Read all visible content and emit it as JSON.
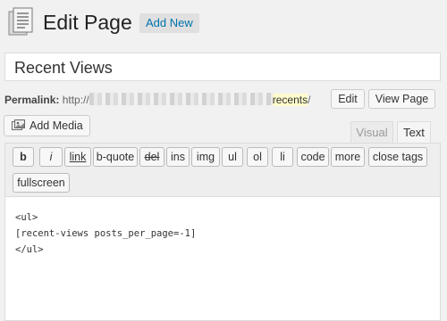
{
  "header": {
    "title": "Edit Page",
    "add_new_label": "Add New"
  },
  "post": {
    "title": "Recent Views"
  },
  "permalink": {
    "label": "Permalink:",
    "url_prefix": "http://",
    "slug": "recents",
    "url_suffix": "/",
    "edit_label": "Edit",
    "view_label": "View Page"
  },
  "media": {
    "add_media_label": "Add Media"
  },
  "editor_tabs": {
    "visual": "Visual",
    "text": "Text",
    "active": "Text"
  },
  "quicktags": [
    {
      "label": "b"
    },
    {
      "label": "i"
    },
    {
      "label": "link"
    },
    {
      "label": "b-quote"
    },
    {
      "label": "del"
    },
    {
      "label": "ins"
    },
    {
      "label": "img"
    },
    {
      "label": "ul"
    },
    {
      "label": "ol"
    },
    {
      "label": "li"
    },
    {
      "label": "code"
    },
    {
      "label": "more"
    },
    {
      "label": "close tags"
    },
    {
      "label": "fullscreen"
    }
  ],
  "content": {
    "lines": [
      "<ul>",
      "[recent-views posts_per_page=-1]",
      "</ul>"
    ]
  },
  "colors": {
    "link": "#0073aa",
    "slug_highlight": "#fffbcc",
    "background": "#f1f1f1"
  }
}
